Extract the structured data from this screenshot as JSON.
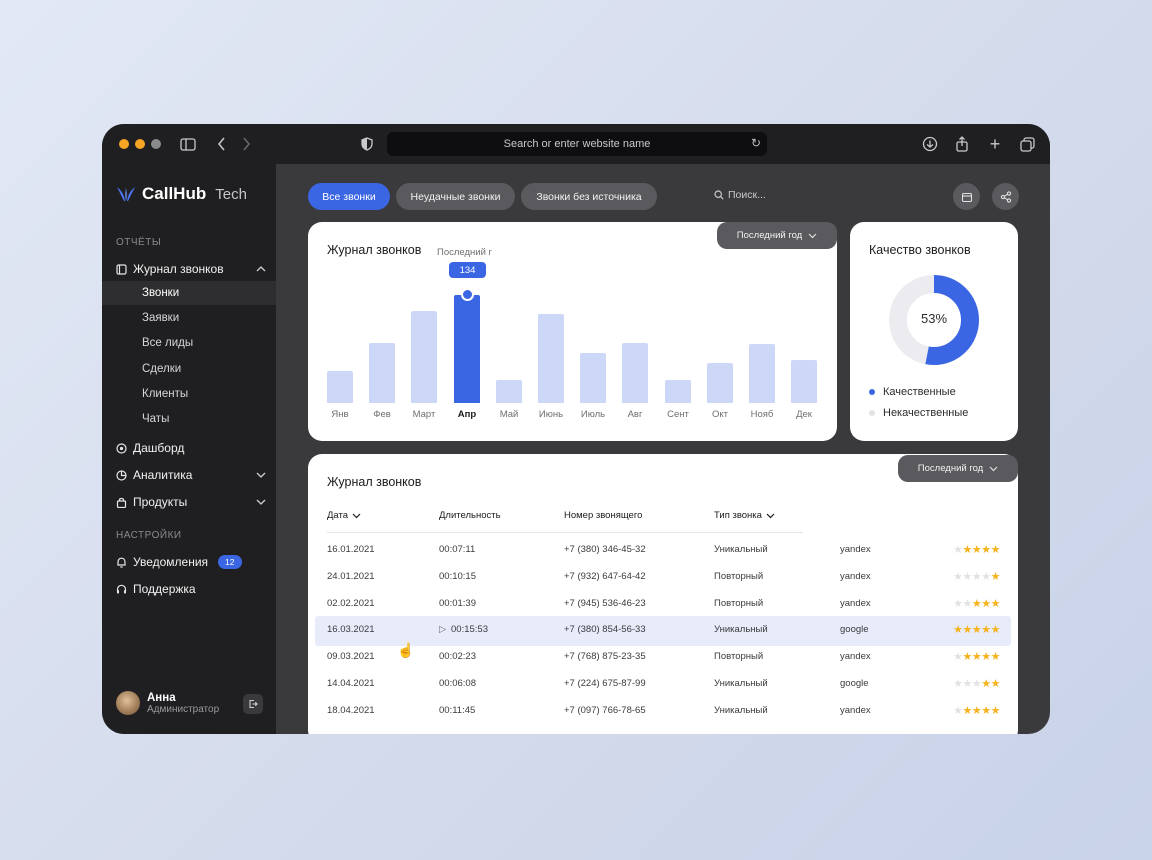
{
  "browser": {
    "url_placeholder": "Search or enter website name"
  },
  "app": {
    "logo_text": "CallHub",
    "logo_sub": "Tech"
  },
  "sidebar": {
    "section_reports": "ОТЧЁТЫ",
    "call_log": "Журнал звонков",
    "subitems": [
      "Звонки",
      "Заявки",
      "Все лиды",
      "Сделки",
      "Клиенты",
      "Чаты"
    ],
    "dashboard": "Дашборд",
    "analytics": "Аналитика",
    "products": "Продукты",
    "section_settings": "НАСТРОЙКИ",
    "notifications": "Уведомления",
    "notifications_count": "12",
    "support": "Поддержка",
    "user_name": "Анна",
    "user_role": "Администратор"
  },
  "toolbar": {
    "chips": [
      "Все звонки",
      "Неудачные звонки",
      "Звонки без источника"
    ],
    "search_placeholder": "Поиск..."
  },
  "chart_card": {
    "title": "Журнал звонков",
    "subtitle": "Последний г",
    "filter": "Последний год",
    "tooltip": "134"
  },
  "chart_data": {
    "type": "bar",
    "categories": [
      "Янв",
      "Фев",
      "Март",
      "Апр",
      "Май",
      "Июнь",
      "Июль",
      "Авг",
      "Сент",
      "Окт",
      "Нояб",
      "Дек"
    ],
    "values": [
      40,
      74,
      114,
      134,
      28,
      110,
      62,
      74,
      28,
      50,
      73,
      53
    ],
    "highlighted_index": 3,
    "ylim": [
      0,
      134
    ],
    "colors": {
      "bar": "#cdd8f8",
      "highlight": "#3b66e3"
    }
  },
  "quality_card": {
    "title": "Качество звонков",
    "percent_label": "53%",
    "percent": 53,
    "legend": [
      "Качественные",
      "Некачественные"
    ],
    "colors": [
      "#3b66e3",
      "#ececf0"
    ]
  },
  "table_card": {
    "title": "Журнал звонков",
    "filter": "Последний год",
    "headers": [
      "Дата",
      "Длительность",
      "Номер звонящего",
      "Тип звонка"
    ],
    "rows": [
      {
        "date": "16.01.2021",
        "duration": "00:07:11",
        "phone": "+7 (380) 346-45-32",
        "type": "Уникальный",
        "source": "yandex",
        "rating": 4
      },
      {
        "date": "24.01.2021",
        "duration": "00:10:15",
        "phone": "+7 (932) 647-64-42",
        "type": "Повторный",
        "source": "yandex",
        "rating": 1
      },
      {
        "date": "02.02.2021",
        "duration": "00:01:39",
        "phone": "+7 (945) 536-46-23",
        "type": "Повторный",
        "source": "yandex",
        "rating": 3
      },
      {
        "date": "16.03.2021",
        "duration": "00:15:53",
        "phone": "+7 (380) 854-56-33",
        "type": "Уникальный",
        "source": "google",
        "rating": 5
      },
      {
        "date": "09.03.2021",
        "duration": "00:02:23",
        "phone": "+7 (768) 875-23-35",
        "type": "Повторный",
        "source": "yandex",
        "rating": 4
      },
      {
        "date": "14.04.2021",
        "duration": "00:06:08",
        "phone": "+7 (224) 675-87-99",
        "type": "Уникальный",
        "source": "google",
        "rating": 2
      },
      {
        "date": "18.04.2021",
        "duration": "00:11:45",
        "phone": "+7 (097) 766-78-65",
        "type": "Уникальный",
        "source": "yandex",
        "rating": 4
      }
    ],
    "highlighted_row": 3
  }
}
